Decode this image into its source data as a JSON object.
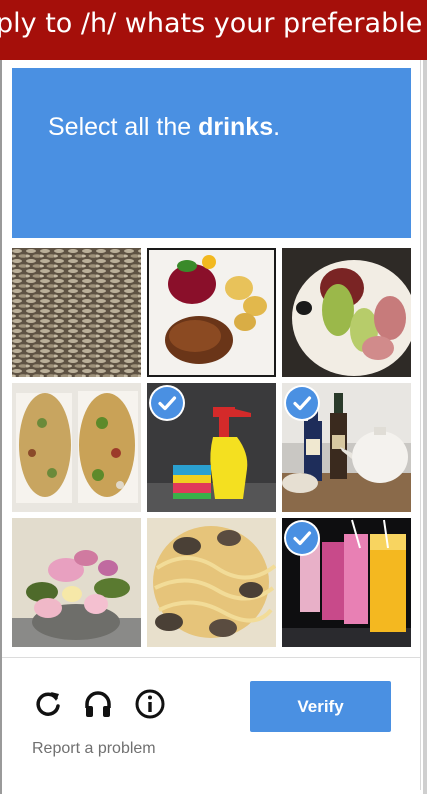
{
  "topbar": {
    "title": "ply to /h/ whats your preferable br..."
  },
  "challenge": {
    "prompt_prefix": "Select all the ",
    "prompt_keyword": "drinks",
    "prompt_suffix": "."
  },
  "tiles": [
    {
      "id": 1,
      "subject": "rice-grains",
      "selected": false
    },
    {
      "id": 2,
      "subject": "plate-with-patty-beets-potatoes",
      "selected": false
    },
    {
      "id": 3,
      "subject": "plate-with-salad-and-salami",
      "selected": false
    },
    {
      "id": 4,
      "subject": "two-pizzas",
      "selected": false
    },
    {
      "id": 5,
      "subject": "spray-bottle-and-sponges",
      "selected": true
    },
    {
      "id": 6,
      "subject": "wine-bottles-and-teapot",
      "selected": true
    },
    {
      "id": 7,
      "subject": "flower-arrangement",
      "selected": false
    },
    {
      "id": 8,
      "subject": "clam-spaghetti",
      "selected": false
    },
    {
      "id": 9,
      "subject": "colorful-drink-glasses",
      "selected": true
    }
  ],
  "footer": {
    "icons": [
      "reload-icon",
      "headphones-icon",
      "info-icon"
    ],
    "verify_label": "Verify",
    "report_label": "Report a problem"
  },
  "colors": {
    "accent": "#4a90e2",
    "topbar": "#a50f0a"
  }
}
